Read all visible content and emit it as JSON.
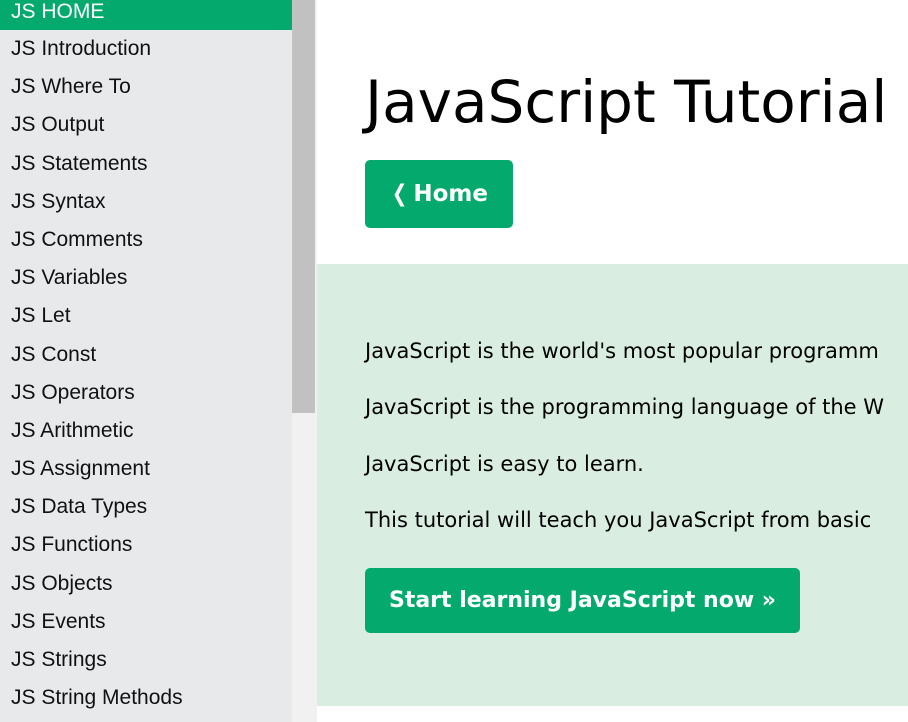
{
  "sidebar": {
    "items": [
      {
        "label": "JS HOME",
        "active": true
      },
      {
        "label": "JS Introduction"
      },
      {
        "label": "JS Where To"
      },
      {
        "label": "JS Output"
      },
      {
        "label": "JS Statements"
      },
      {
        "label": "JS Syntax"
      },
      {
        "label": "JS Comments"
      },
      {
        "label": "JS Variables"
      },
      {
        "label": "JS Let"
      },
      {
        "label": "JS Const"
      },
      {
        "label": "JS Operators"
      },
      {
        "label": "JS Arithmetic"
      },
      {
        "label": "JS Assignment"
      },
      {
        "label": "JS Data Types"
      },
      {
        "label": "JS Functions"
      },
      {
        "label": "JS Objects"
      },
      {
        "label": "JS Events"
      },
      {
        "label": "JS Strings"
      },
      {
        "label": "JS String Methods"
      }
    ]
  },
  "main": {
    "title": "JavaScript Tutorial",
    "home_button": {
      "icon": "chevron-left-icon",
      "label": "Home"
    },
    "intro": {
      "lines": [
        "JavaScript is the world's most popular programm",
        "JavaScript is the programming language of the W",
        "JavaScript is easy to learn.",
        "This tutorial will teach you JavaScript from basic"
      ],
      "start_button_label": "Start learning JavaScript now »"
    }
  },
  "colors": {
    "accent": "#04aa6d",
    "sidebar_bg": "#e7e9eb",
    "panel_bg": "#d9eee1"
  }
}
